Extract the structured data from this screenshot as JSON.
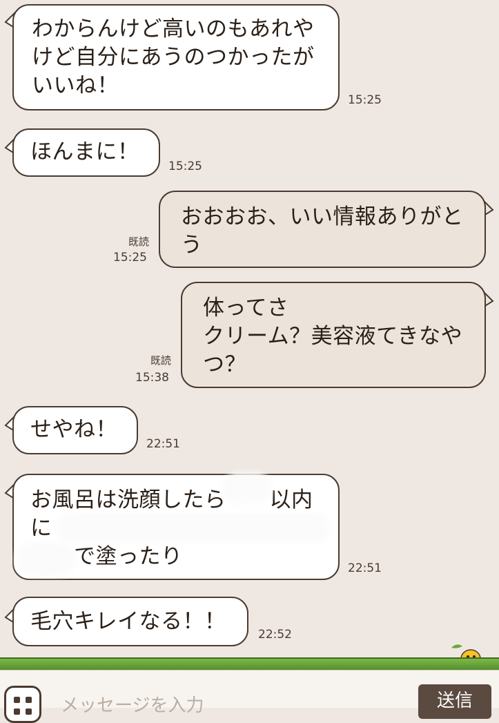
{
  "messages": [
    {
      "side": "in",
      "text": "わからんけど高いのもあれや\nけど自分にあうのつかったが\nいいね！",
      "time": "15:25"
    },
    {
      "side": "in",
      "text": "ほんまに！",
      "time": "15:25"
    },
    {
      "side": "out",
      "text": "おおおお、いい情報ありがと\nう",
      "time": "15:25",
      "read": "既読"
    },
    {
      "side": "out",
      "text": "体ってさ\nクリーム？美容液てきなや\nつ？",
      "time": "15:38",
      "read": "既読"
    },
    {
      "side": "in",
      "text": "せやね！",
      "time": "22:51"
    },
    {
      "side": "in",
      "text": "お風呂は洗顔したら　　以内\nに\n　　で塗ったり",
      "time": "22:51"
    },
    {
      "side": "in",
      "text": "毛穴キレイなる！！",
      "time": "22:52"
    }
  ],
  "input": {
    "placeholder": "メッセージを入力"
  },
  "send": {
    "label": "送信"
  },
  "icons": {
    "sticker": "sticker-icon",
    "mascot": "chick-mascot-icon"
  },
  "colors": {
    "background": "#efe8e2",
    "incoming": "#ffffff",
    "outgoing": "#ece4da",
    "border": "#4a3a30",
    "ground": "#6aa83c"
  }
}
